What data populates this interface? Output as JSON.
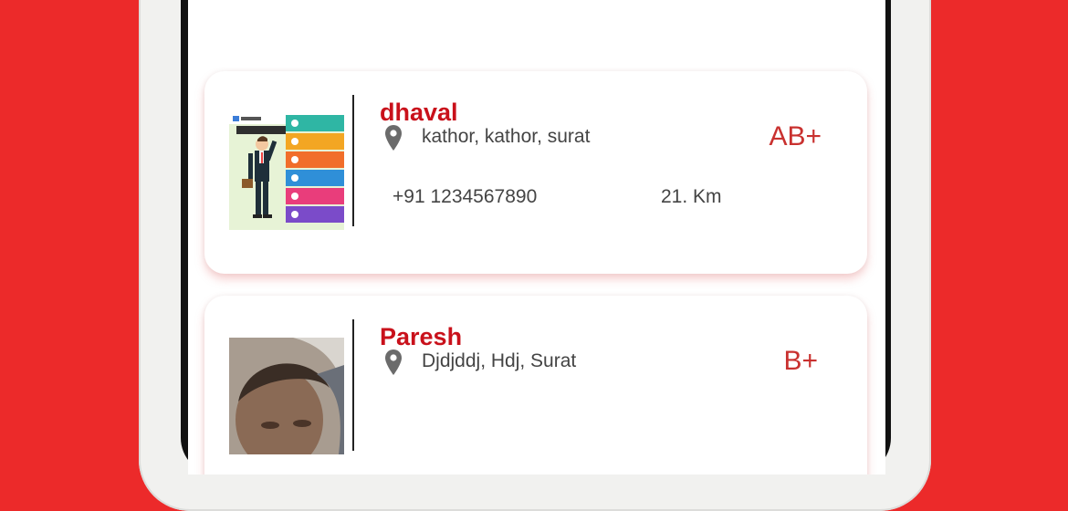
{
  "filters": [
    "",
    "",
    "",
    ""
  ],
  "donors": [
    {
      "name": "dhaval",
      "address": "kathor, kathor, surat",
      "blood_group": "AB+",
      "phone": "+91 1234567890",
      "distance": "21. Km",
      "photo": "infographic-image"
    },
    {
      "name": "Paresh",
      "address": "Djdjddj, Hdj, Surat",
      "blood_group": "B+",
      "photo": "person-photo"
    }
  ],
  "colors": {
    "background": "#ec2a2a",
    "accent": "#c9111b",
    "blood_group": "#c9312f"
  }
}
